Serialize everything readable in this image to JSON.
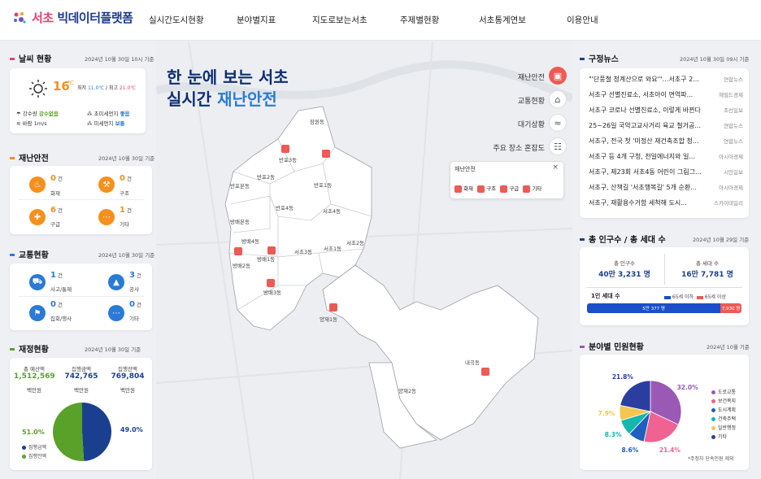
{
  "header": {
    "logo_prefix": "서초",
    "logo_suffix": " 빅데이터플랫폼",
    "nav": [
      "실시간도시현황",
      "분야별지표",
      "지도로보는서초",
      "주제별현황",
      "서초통계연보",
      "이용안내"
    ]
  },
  "weather": {
    "title": "날씨 현황",
    "date": "2024년 10월 30일 10시 기준",
    "temp": "16",
    "temp_unit": "℃",
    "max_label": "최저",
    "max_value": "11.0℃",
    "min_label": "/ 최고",
    "min_value": "21.0℃",
    "rain_label": "강수량",
    "rain_value": "강수없음",
    "fine_dust_label": "초미세먼지",
    "fine_dust_value": "좋음",
    "wind_label": "바람",
    "wind_value": "1m/s",
    "dust_label": "미세먼지",
    "dust_value": "보통"
  },
  "disaster": {
    "title": "재난안전",
    "date": "2024년 10월 30일 기준",
    "items": [
      {
        "num": "0",
        "unit": "건",
        "label": "화재",
        "icon": "fire-icon"
      },
      {
        "num": "0",
        "unit": "건",
        "label": "구조",
        "icon": "rescue-icon"
      },
      {
        "num": "6",
        "unit": "건",
        "label": "구급",
        "icon": "ambulance-icon"
      },
      {
        "num": "1",
        "unit": "건",
        "label": "기타",
        "icon": "more-icon"
      }
    ],
    "color": "#f5901e"
  },
  "traffic": {
    "title": "교통현황",
    "date": "2024년 10월 30일 기준",
    "items": [
      {
        "num": "1",
        "unit": "건",
        "label": "사고/통제",
        "icon": "car-accident-icon"
      },
      {
        "num": "3",
        "unit": "건",
        "label": "공사",
        "icon": "construction-icon"
      },
      {
        "num": "0",
        "unit": "건",
        "label": "집회/행사",
        "icon": "rally-icon"
      },
      {
        "num": "0",
        "unit": "건",
        "label": "기타",
        "icon": "more-icon"
      }
    ],
    "color": "#2a7ad6"
  },
  "finance": {
    "title": "재정현황",
    "date": "2024년 10월 30일 기준",
    "cols": [
      {
        "label": "총 예산액",
        "value": "1,512,569",
        "unit": "백만원",
        "color": "#5aa12a"
      },
      {
        "label": "집행금액",
        "value": "742,765",
        "unit": "백만원",
        "color": "#1b3f8f"
      },
      {
        "label": "집행잔액",
        "value": "769,804",
        "unit": "백만원",
        "color": "#1b3f8f"
      }
    ],
    "left_pct": "51.0%",
    "right_pct": "49.0%",
    "legend": [
      "집행금액",
      "집행잔액"
    ]
  },
  "hero": {
    "line1": "한 눈에 보는 서초",
    "line2_prefix": "실시간 ",
    "line2_highlight": "재난안전"
  },
  "map_categories": [
    {
      "label": "재난안전",
      "icon": "alarm-icon",
      "active": true
    },
    {
      "label": "교통현황",
      "icon": "bus-icon",
      "active": false
    },
    {
      "label": "대기상황",
      "icon": "air-icon",
      "active": false
    },
    {
      "label": "주요 장소 혼잡도",
      "icon": "crowd-icon",
      "active": false
    }
  ],
  "map_legend": {
    "title": "재난안전",
    "close": "×",
    "items": [
      "화재",
      "구조",
      "구급",
      "기타"
    ]
  },
  "dongs": [
    "잠원동",
    "반포3동",
    "반포2동",
    "반포본동",
    "반포1동",
    "반포4동",
    "방배본동",
    "방배4동",
    "방배1동",
    "방배2동",
    "방배3동",
    "서초3동",
    "서초1동",
    "서초4동",
    "서초2동",
    "양재1동",
    "양재2동",
    "내곡동"
  ],
  "news": {
    "title": "구정뉴스",
    "date": "2024년 10월 30일 09시 기준",
    "items": [
      {
        "title": "\"'단풍철 청계산으로 와요'\"…서초구 2...",
        "source": "연합뉴스"
      },
      {
        "title": "서초구 선별진료소, 서초아이 면역파...",
        "source": "헤럴드경제"
      },
      {
        "title": "서초구 코로나 선별진료소, 이렇게 바뀐다",
        "source": "조선일보"
      },
      {
        "title": "25~26일 국악고교사거리 육교 철거공...",
        "source": "연합뉴스"
      },
      {
        "title": "서초구, 전국 첫 '미정산 재건축조합 청...",
        "source": "연합뉴스"
      },
      {
        "title": "서초구 등 4개 구청, 천일에너지와 일...",
        "source": "아시아경제"
      },
      {
        "title": "서초구, 제23회 서초4동 어린이 그림그...",
        "source": "시민일보"
      },
      {
        "title": "서초구, 산책길 '서초행복길' 5개 순환...",
        "source": "아시아경제"
      },
      {
        "title": "서초구, 재활용수거함 세척해 도시...",
        "source": "스카이데일리"
      }
    ]
  },
  "population": {
    "title": "총 인구수 / 총 세대 수",
    "date": "2024년 10월 29일 기준",
    "pop_label": "총 인구수",
    "pop_value": "40만 3,231 명",
    "hh_label": "총 세대 수",
    "hh_value": "16만 7,781 명",
    "single_label": "1인 세대 수",
    "under_label": "65세 이하",
    "over_label": "65세 이상",
    "under_value": "5만 377 명",
    "over_value": "7,930 명",
    "under_count": 50377,
    "over_count": 7930
  },
  "complaints": {
    "title": "분야별 민원현황",
    "date": "2024년 10월 기준",
    "note": "*주정차 단속민원 제외",
    "chart_data": {
      "type": "pie",
      "labels": [
        "도로교통",
        "보건복지",
        "도시계획",
        "건축주택",
        "일반행정",
        "기타"
      ],
      "values": [
        32.0,
        21.4,
        8.6,
        8.3,
        7.9,
        21.8
      ],
      "value_labels": [
        "32.0%",
        "21.4%",
        "8.6%",
        "8.3%",
        "7.9%",
        "21.8%"
      ],
      "colors": [
        "#9b59b6",
        "#f06291",
        "#1f5fc0",
        "#15b6b0",
        "#f4c64f",
        "#2c3da0"
      ]
    }
  }
}
